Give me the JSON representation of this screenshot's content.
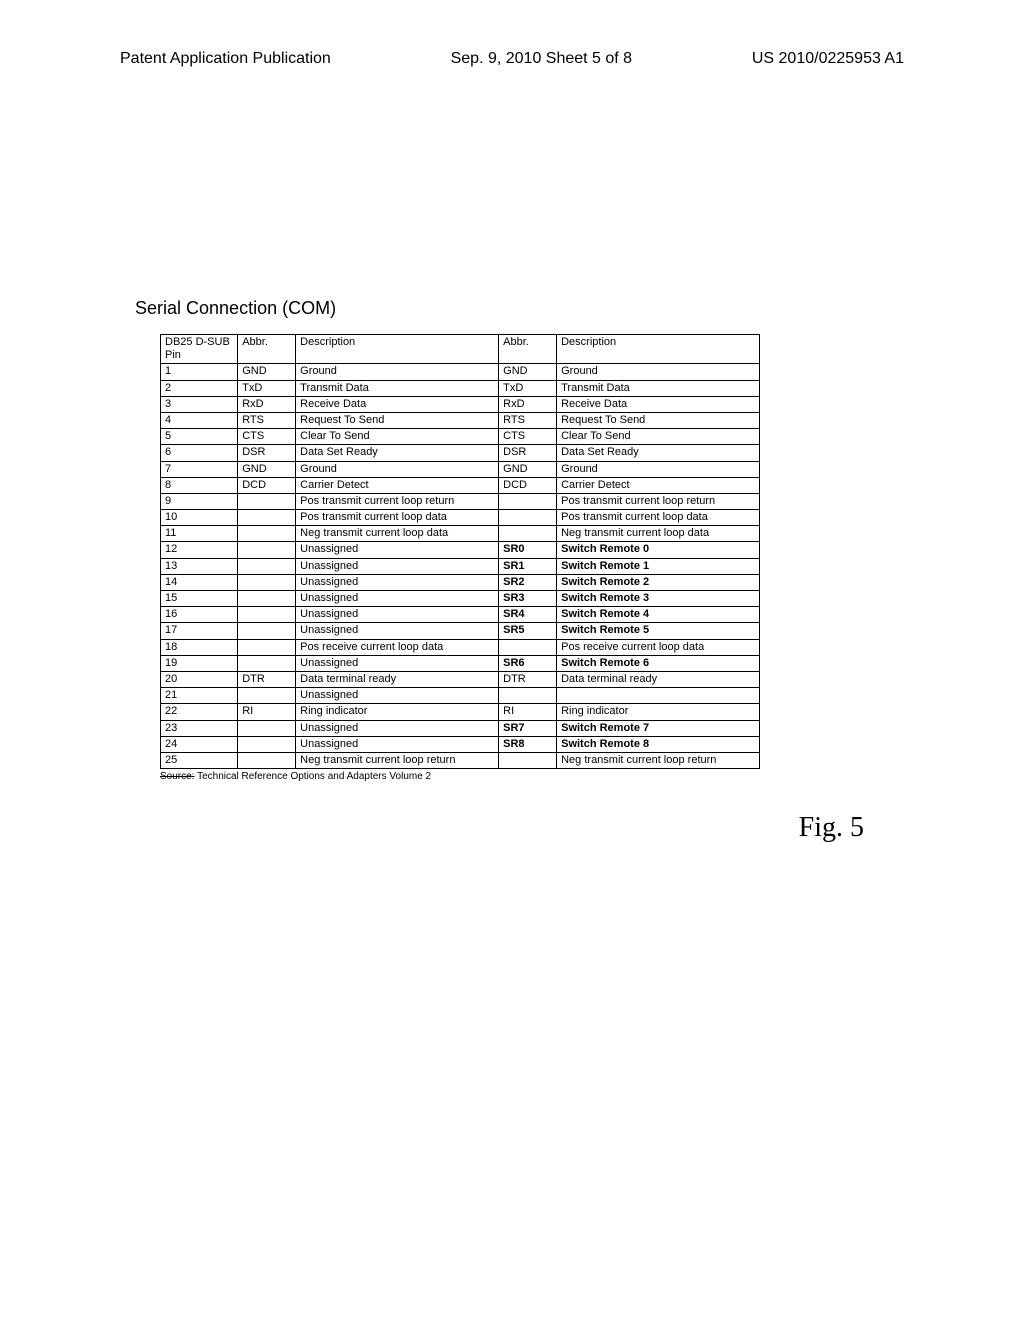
{
  "header": {
    "left": "Patent Application Publication",
    "center": "Sep. 9, 2010   Sheet 5 of 8",
    "right": "US 2010/0225953 A1"
  },
  "title": "Serial Connection (COM)",
  "columns": {
    "pin": "DB25 D-SUB Pin",
    "abbr1": "Abbr.",
    "desc1": "Description",
    "abbr2": "Abbr.",
    "desc2": "Description"
  },
  "rows": [
    {
      "pin": "1",
      "a1": "GND",
      "d1": "Ground",
      "a2": "GND",
      "d2": "Ground",
      "bold": false
    },
    {
      "pin": "2",
      "a1": "TxD",
      "d1": "Transmit Data",
      "a2": "TxD",
      "d2": "Transmit Data",
      "bold": false
    },
    {
      "pin": "3",
      "a1": "RxD",
      "d1": "Receive Data",
      "a2": "RxD",
      "d2": "Receive Data",
      "bold": false
    },
    {
      "pin": "4",
      "a1": "RTS",
      "d1": "Request To Send",
      "a2": "RTS",
      "d2": "Request To Send",
      "bold": false
    },
    {
      "pin": "5",
      "a1": "CTS",
      "d1": "Clear To Send",
      "a2": "CTS",
      "d2": "Clear To Send",
      "bold": false
    },
    {
      "pin": "6",
      "a1": "DSR",
      "d1": "Data Set Ready",
      "a2": "DSR",
      "d2": "Data Set Ready",
      "bold": false
    },
    {
      "pin": "7",
      "a1": "GND",
      "d1": "Ground",
      "a2": "GND",
      "d2": "Ground",
      "bold": false
    },
    {
      "pin": "8",
      "a1": "DCD",
      "d1": "Carrier Detect",
      "a2": "DCD",
      "d2": "Carrier Detect",
      "bold": false
    },
    {
      "pin": "9",
      "a1": "",
      "d1": "Pos transmit current loop return",
      "a2": "",
      "d2": "Pos transmit current loop return",
      "bold": false
    },
    {
      "pin": "10",
      "a1": "",
      "d1": "Pos transmit current loop data",
      "a2": "",
      "d2": "Pos transmit current loop data",
      "bold": false
    },
    {
      "pin": "11",
      "a1": "",
      "d1": "Neg transmit current loop data",
      "a2": "",
      "d2": "Neg transmit current loop data",
      "bold": false
    },
    {
      "pin": "12",
      "a1": "",
      "d1": "Unassigned",
      "a2": "SR0",
      "d2": "Switch Remote 0",
      "bold": true
    },
    {
      "pin": "13",
      "a1": "",
      "d1": "Unassigned",
      "a2": "SR1",
      "d2": "Switch Remote 1",
      "bold": true
    },
    {
      "pin": "14",
      "a1": "",
      "d1": "Unassigned",
      "a2": "SR2",
      "d2": "Switch Remote 2",
      "bold": true
    },
    {
      "pin": "15",
      "a1": "",
      "d1": "Unassigned",
      "a2": "SR3",
      "d2": "Switch Remote 3",
      "bold": true
    },
    {
      "pin": "16",
      "a1": "",
      "d1": "Unassigned",
      "a2": "SR4",
      "d2": "Switch Remote 4",
      "bold": true
    },
    {
      "pin": "17",
      "a1": "",
      "d1": "Unassigned",
      "a2": "SR5",
      "d2": "Switch Remote 5",
      "bold": true
    },
    {
      "pin": "18",
      "a1": "",
      "d1": "Pos receive current loop data",
      "a2": "",
      "d2": "Pos receive current loop data",
      "bold": false
    },
    {
      "pin": "19",
      "a1": "",
      "d1": "Unassigned",
      "a2": "SR6",
      "d2": "Switch Remote 6",
      "bold": true
    },
    {
      "pin": "20",
      "a1": "DTR",
      "d1": "Data terminal ready",
      "a2": "DTR",
      "d2": "Data terminal ready",
      "bold": false
    },
    {
      "pin": "21",
      "a1": "",
      "d1": "Unassigned",
      "a2": "",
      "d2": "",
      "bold": false
    },
    {
      "pin": "22",
      "a1": "RI",
      "d1": "Ring indicator",
      "a2": "RI",
      "d2": "Ring indicator",
      "bold": false
    },
    {
      "pin": "23",
      "a1": "",
      "d1": "Unassigned",
      "a2": "SR7",
      "d2": "Switch Remote 7",
      "bold": true
    },
    {
      "pin": "24",
      "a1": "",
      "d1": "Unassigned",
      "a2": "SR8",
      "d2": "Switch Remote 8",
      "bold": true
    },
    {
      "pin": "25",
      "a1": "",
      "d1": "Neg transmit current loop return",
      "a2": "",
      "d2": "Neg transmit current loop return",
      "bold": false
    }
  ],
  "source": {
    "strike": "Source:",
    "text": "Technical Reference Options and Adapters Volume 2"
  },
  "figure": "Fig. 5"
}
